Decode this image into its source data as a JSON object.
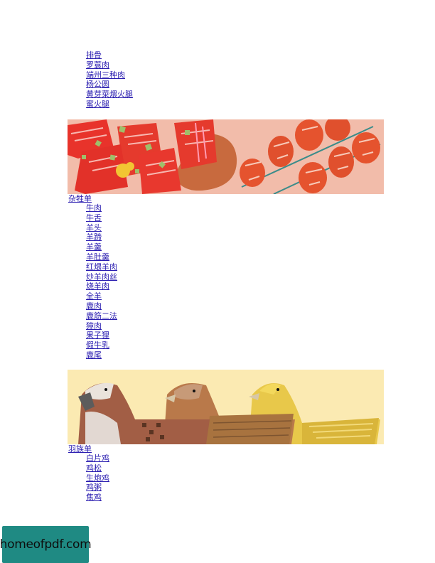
{
  "top_list": [
    "排骨",
    "罗蓑肉",
    "端州三种肉",
    "杨公圆",
    "黄芽菜煨火腿",
    "蜜火腿"
  ],
  "section2": {
    "title": "杂牲单",
    "items": [
      "牛肉",
      "牛舌",
      "羊头",
      "羊蹄",
      "羊羹",
      "羊肚羹",
      "红煨羊肉",
      "炒羊肉丝",
      "烧羊肉",
      "全羊",
      "鹿肉",
      "鹿筋二法",
      "獐肉",
      "果子狸",
      "假牛乳",
      "鹿尾"
    ]
  },
  "section3": {
    "title": "羽族单",
    "items": [
      "白片鸡",
      "鸡松",
      "生炮鸡",
      "鸡粥",
      "焦鸡"
    ]
  },
  "watermark": {
    "text": "homeofpdf.com",
    "bg_color": "#1f8a83"
  },
  "colors": {
    "link": "#2a1db0",
    "banner1_bg": "#f2bcaa",
    "banner2_bg": "#fbeab2"
  }
}
